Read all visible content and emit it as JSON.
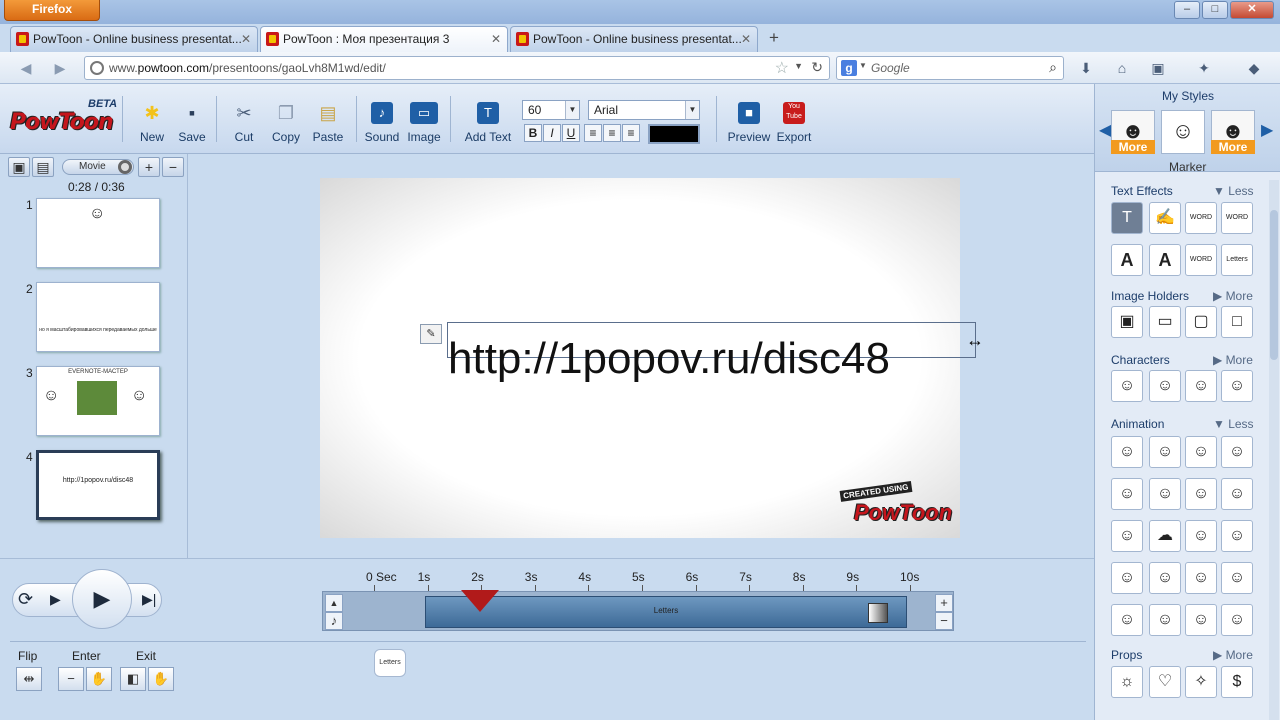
{
  "browser": {
    "app_button": "Firefox",
    "window_controls": {
      "minimize": "–",
      "maximize": "□",
      "close": "✕"
    },
    "tabs": [
      {
        "label": "PowToon - Online business presentat...",
        "active": false
      },
      {
        "label": "PowToon : Моя презентация 3",
        "active": true
      },
      {
        "label": "PowToon - Online business presentat...",
        "active": false
      }
    ],
    "new_tab": "+",
    "url_prefix": "www.",
    "url_domain": "powtoon.com",
    "url_path": "/presentoons/gaoLvh8M1wd/edit/",
    "search_engine_letter": "g",
    "search_placeholder": "Google"
  },
  "app": {
    "logo": "PowToon",
    "beta": "BETA",
    "toolbar": {
      "new": "New",
      "save": "Save",
      "cut": "Cut",
      "copy": "Copy",
      "paste": "Paste",
      "sound": "Sound",
      "image": "Image",
      "add_text": "Add Text",
      "add_text_icon": "T",
      "preview": "Preview",
      "export": "Export",
      "export_icon": "You Tube",
      "font_size": "60",
      "font_name": "Arial",
      "bold": "B",
      "italic": "I",
      "underline": "U",
      "text_color": "#000000"
    },
    "slides_panel": {
      "movie_label": "Movie",
      "add": "+",
      "remove": "−",
      "time": "0:28 / 0:36",
      "slides": [
        {
          "number": "1",
          "text": ""
        },
        {
          "number": "2",
          "text": "но я масштабировавшихся передаваемых дольше"
        },
        {
          "number": "3",
          "text": "EVERNOTE-МАСТЕР"
        },
        {
          "number": "4",
          "text": "http://1popov.ru/disc48"
        }
      ]
    },
    "canvas": {
      "main_text": "http://1popov.ru/disc48",
      "watermark_created": "CREATED USING",
      "watermark_logo": "PowToon"
    },
    "timeline": {
      "ticks": [
        "0 Sec",
        "1s",
        "2s",
        "3s",
        "4s",
        "5s",
        "6s",
        "7s",
        "8s",
        "9s",
        "10s"
      ],
      "bar_label": "Letters",
      "plus": "+",
      "minus": "−",
      "flip": "Flip",
      "enter": "Enter",
      "exit": "Exit",
      "letters_chip": "Letters"
    },
    "styles_panel": {
      "title": "My Styles",
      "more_left": "More",
      "more_right": "More",
      "current_style": "Marker",
      "sections": [
        {
          "title": "Text Effects",
          "toggle": "▼ Less"
        },
        {
          "title": "Image Holders",
          "toggle": "▶ More"
        },
        {
          "title": "Characters",
          "toggle": "▶ More"
        },
        {
          "title": "Animation",
          "toggle": "▼ Less"
        },
        {
          "title": "Props",
          "toggle": "▶ More"
        }
      ],
      "text_effect_labels": [
        "T",
        "",
        "WORD",
        "WORD",
        "A",
        "A",
        "WORD",
        "Letters"
      ]
    }
  }
}
